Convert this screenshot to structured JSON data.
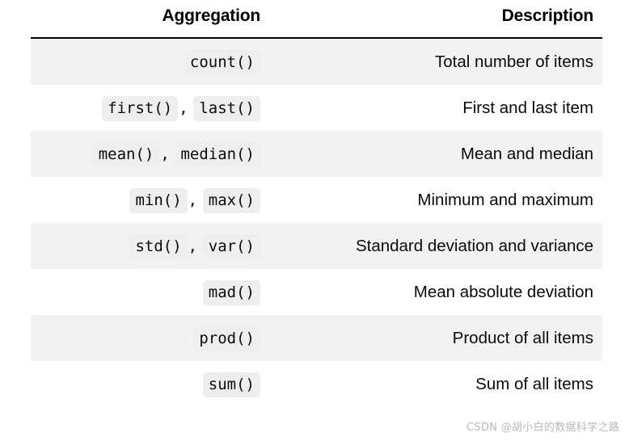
{
  "table": {
    "headers": {
      "aggregation": "Aggregation",
      "description": "Description"
    },
    "rows": [
      {
        "funcs": [
          "count()"
        ],
        "separator": ",",
        "description": "Total number of items"
      },
      {
        "funcs": [
          "first()",
          "last()"
        ],
        "separator": ",",
        "description": "First and last item"
      },
      {
        "funcs": [
          "mean()",
          "median()"
        ],
        "separator": ",",
        "description": "Mean and median"
      },
      {
        "funcs": [
          "min()",
          "max()"
        ],
        "separator": ",",
        "description": "Minimum and maximum"
      },
      {
        "funcs": [
          "std()",
          "var()"
        ],
        "separator": ",",
        "description": "Standard deviation and variance"
      },
      {
        "funcs": [
          "mad()"
        ],
        "separator": ",",
        "description": "Mean absolute deviation"
      },
      {
        "funcs": [
          "prod()"
        ],
        "separator": ",",
        "description": "Product of all items"
      },
      {
        "funcs": [
          "sum()"
        ],
        "separator": ",",
        "description": "Sum of all items"
      }
    ]
  },
  "watermark": {
    "text": "CSDN @胡小白的数据科学之路"
  },
  "colors": {
    "stripe": "#f2f2f2",
    "code_bg": "#eeeeef",
    "rule": "#000000",
    "text": "#0a0a0a",
    "watermark": "#b8b8b8"
  }
}
